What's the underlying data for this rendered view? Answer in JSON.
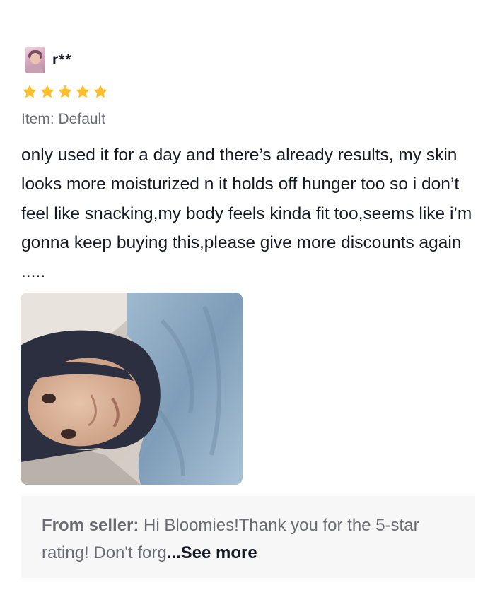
{
  "review": {
    "username": "r**",
    "rating": 5,
    "rating_max": 5,
    "star_color": "#fcbe2c",
    "item_variant": "Item: Default",
    "text": "only used it for a day and there’s already results, my skin looks more moisturized n it holds off hunger too so i don’t feel like snacking,my body feels kinda fit too,seems like i’m gonna keep buying this,please give more discounts again .....",
    "photo_icon": "review-photo"
  },
  "seller_reply": {
    "label": "From seller:",
    "text": " Hi Bloomies!Thank you for the 5-star rating! Don't forg",
    "see_more": "...See more"
  }
}
